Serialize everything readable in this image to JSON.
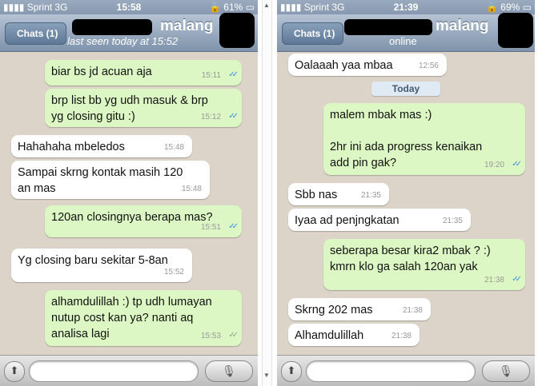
{
  "left": {
    "status": {
      "carrier": "Sprint  3G",
      "time": "15:58",
      "battery": "61%"
    },
    "nav": {
      "back_label": "Chats (1)",
      "title": "malang",
      "subtitle": "last seen today at 15:52"
    },
    "messages": [
      {
        "dir": "out",
        "text": "biar bs jd acuan aja",
        "time": "15:11",
        "status": "read"
      },
      {
        "dir": "out",
        "text": "brp list bb yg udh masuk & brp\nyg closing gitu :)",
        "time": "15:12",
        "status": "read"
      },
      {
        "dir": "in",
        "text": "Hahahaha mbeledos",
        "time": "15:48"
      },
      {
        "dir": "in",
        "text": "Sampai skrng kontak masih 120\nan mas",
        "time": "15:48"
      },
      {
        "dir": "out",
        "text": "120an closingnya berapa mas?",
        "time": "15:51",
        "status": "read"
      },
      {
        "dir": "in",
        "text": "Yg closing baru sekitar 5-8an",
        "time": "15:52"
      },
      {
        "dir": "out",
        "text": "alhamdulillah :) tp udh lumayan\nnutup cost kan ya? nanti aq\nanalisa lagi",
        "time": "15:53",
        "status": "delivered"
      }
    ]
  },
  "right": {
    "status": {
      "carrier": "Sprint  3G",
      "time": "21:39",
      "battery": "69%"
    },
    "nav": {
      "back_label": "Chats (1)",
      "title": "malang",
      "subtitle": "online"
    },
    "day_separator": "Today",
    "messages": [
      {
        "dir": "in",
        "text": "Oalaaah yaa mbaa",
        "time": "12:56"
      },
      {
        "dir": "out",
        "text": "malem mbak mas :)\n\n2hr ini ada progress kenaikan\nadd pin gak?",
        "time": "19:20",
        "status": "read"
      },
      {
        "dir": "in",
        "text": "Sbb nas",
        "time": "21:35"
      },
      {
        "dir": "in",
        "text": "Iyaa ad penjngkatan",
        "time": "21:35"
      },
      {
        "dir": "out",
        "text": "seberapa besar kira2 mbak ? :)\nkmrn klo ga salah 120an yak",
        "time": "21:38",
        "status": "read"
      },
      {
        "dir": "in",
        "text": "Skrng 202 mas",
        "time": "21:38"
      },
      {
        "dir": "in",
        "text": "Alhamdulillah",
        "time": "21:38"
      }
    ]
  },
  "icons": {
    "signal": "signal-bars-icon",
    "lock": "lock-icon",
    "battery": "battery-icon",
    "attach": "upload-arrow-icon",
    "mic": "microphone-icon",
    "read": "double-check-icon"
  },
  "colors": {
    "outgoing_bubble": "#dcf7c3",
    "incoming_bubble": "#ffffff",
    "nav_bar": "#8799b0",
    "read_tick": "#3b8ee0"
  }
}
